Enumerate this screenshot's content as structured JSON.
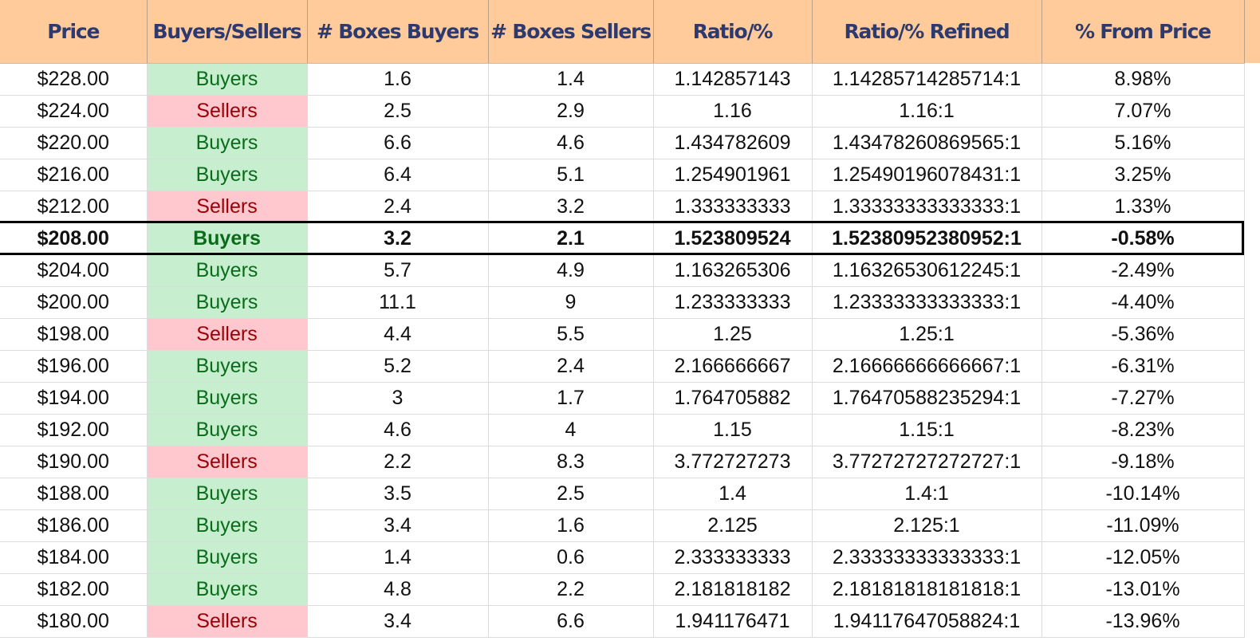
{
  "columns": [
    "Price",
    "Buyers/Sellers",
    "# Boxes Buyers",
    "# Boxes Sellers",
    "Ratio/%",
    "Ratio/% Refined",
    "% From Price"
  ],
  "colors": {
    "header_bg": "#ffcb9a",
    "header_text": "#2d3a70",
    "buyers_bg": "#c7efcf",
    "buyers_text": "#0a6b1a",
    "sellers_bg": "#ffc7ce",
    "sellers_text": "#9c0006"
  },
  "rows": [
    {
      "price": "$228.00",
      "side": "Buyers",
      "bb": "1.6",
      "bs": "1.4",
      "ratio": "1.142857143",
      "refined": "1.14285714285714:1",
      "pct": "8.98%"
    },
    {
      "price": "$224.00",
      "side": "Sellers",
      "bb": "2.5",
      "bs": "2.9",
      "ratio": "1.16",
      "refined": "1.16:1",
      "pct": "7.07%"
    },
    {
      "price": "$220.00",
      "side": "Buyers",
      "bb": "6.6",
      "bs": "4.6",
      "ratio": "1.434782609",
      "refined": "1.43478260869565:1",
      "pct": "5.16%"
    },
    {
      "price": "$216.00",
      "side": "Buyers",
      "bb": "6.4",
      "bs": "5.1",
      "ratio": "1.254901961",
      "refined": "1.25490196078431:1",
      "pct": "3.25%"
    },
    {
      "price": "$212.00",
      "side": "Sellers",
      "bb": "2.4",
      "bs": "3.2",
      "ratio": "1.333333333",
      "refined": "1.33333333333333:1",
      "pct": "1.33%"
    },
    {
      "price": "$208.00",
      "side": "Buyers",
      "bb": "3.2",
      "bs": "2.1",
      "ratio": "1.523809524",
      "refined": "1.52380952380952:1",
      "pct": "-0.58%",
      "current": true
    },
    {
      "price": "$204.00",
      "side": "Buyers",
      "bb": "5.7",
      "bs": "4.9",
      "ratio": "1.163265306",
      "refined": "1.16326530612245:1",
      "pct": "-2.49%"
    },
    {
      "price": "$200.00",
      "side": "Buyers",
      "bb": "11.1",
      "bs": "9",
      "ratio": "1.233333333",
      "refined": "1.23333333333333:1",
      "pct": "-4.40%"
    },
    {
      "price": "$198.00",
      "side": "Sellers",
      "bb": "4.4",
      "bs": "5.5",
      "ratio": "1.25",
      "refined": "1.25:1",
      "pct": "-5.36%"
    },
    {
      "price": "$196.00",
      "side": "Buyers",
      "bb": "5.2",
      "bs": "2.4",
      "ratio": "2.166666667",
      "refined": "2.16666666666667:1",
      "pct": "-6.31%"
    },
    {
      "price": "$194.00",
      "side": "Buyers",
      "bb": "3",
      "bs": "1.7",
      "ratio": "1.764705882",
      "refined": "1.76470588235294:1",
      "pct": "-7.27%"
    },
    {
      "price": "$192.00",
      "side": "Buyers",
      "bb": "4.6",
      "bs": "4",
      "ratio": "1.15",
      "refined": "1.15:1",
      "pct": "-8.23%"
    },
    {
      "price": "$190.00",
      "side": "Sellers",
      "bb": "2.2",
      "bs": "8.3",
      "ratio": "3.772727273",
      "refined": "3.77272727272727:1",
      "pct": "-9.18%"
    },
    {
      "price": "$188.00",
      "side": "Buyers",
      "bb": "3.5",
      "bs": "2.5",
      "ratio": "1.4",
      "refined": "1.4:1",
      "pct": "-10.14%"
    },
    {
      "price": "$186.00",
      "side": "Buyers",
      "bb": "3.4",
      "bs": "1.6",
      "ratio": "2.125",
      "refined": "2.125:1",
      "pct": "-11.09%"
    },
    {
      "price": "$184.00",
      "side": "Buyers",
      "bb": "1.4",
      "bs": "0.6",
      "ratio": "2.333333333",
      "refined": "2.33333333333333:1",
      "pct": "-12.05%"
    },
    {
      "price": "$182.00",
      "side": "Buyers",
      "bb": "4.8",
      "bs": "2.2",
      "ratio": "2.181818182",
      "refined": "2.18181818181818:1",
      "pct": "-13.01%"
    },
    {
      "price": "$180.00",
      "side": "Sellers",
      "bb": "3.4",
      "bs": "6.6",
      "ratio": "1.941176471",
      "refined": "1.94117647058824:1",
      "pct": "-13.96%"
    }
  ]
}
